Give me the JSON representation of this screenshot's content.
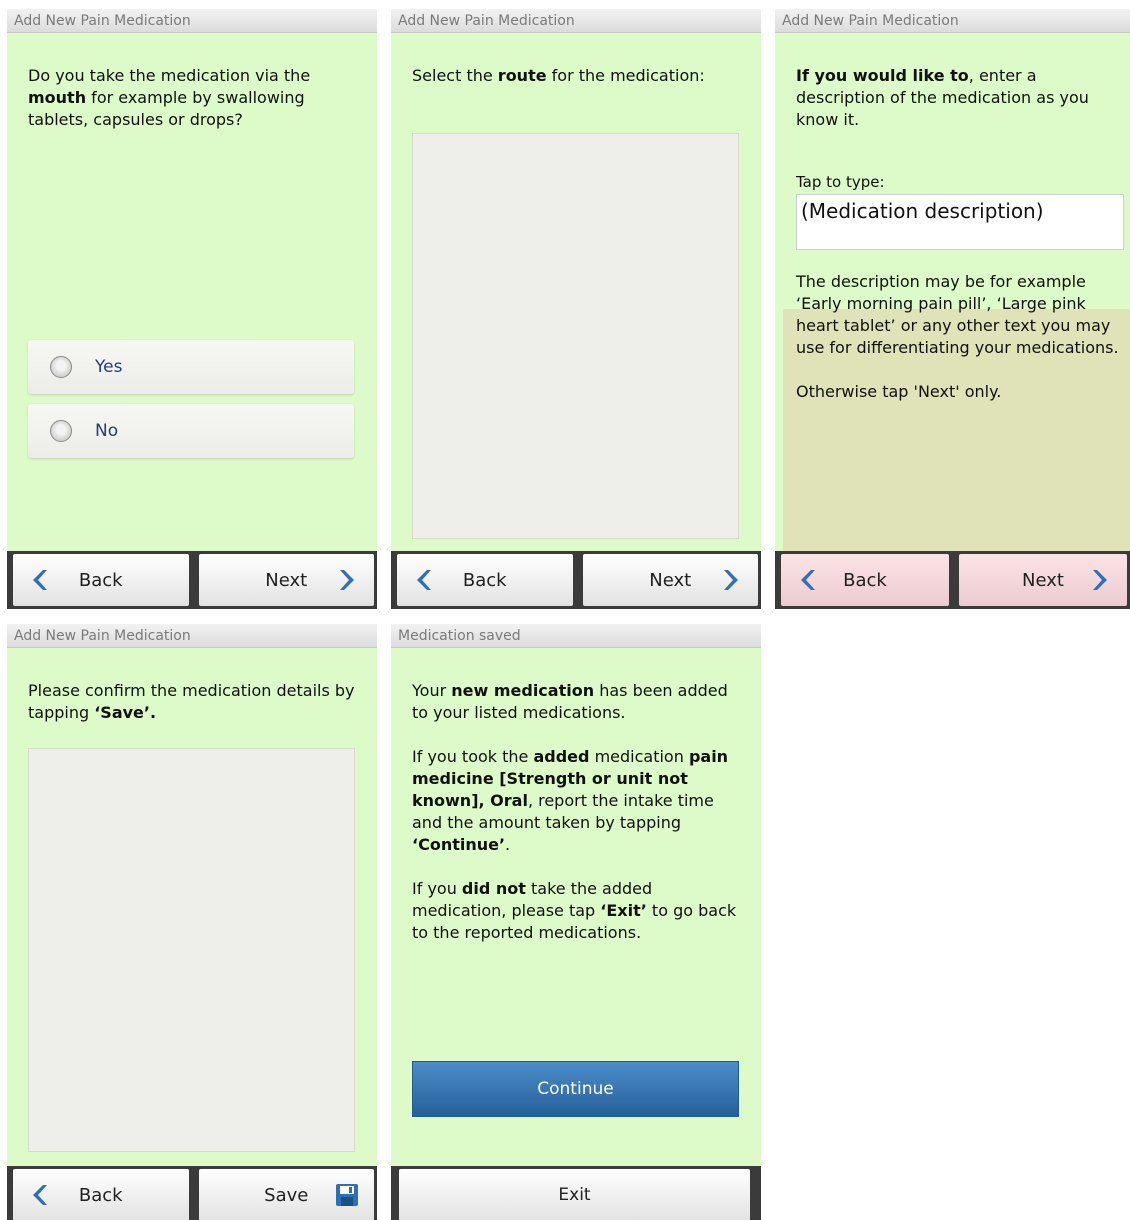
{
  "screen1": {
    "title": "Add New Pain Medication",
    "question": {
      "pre": "Do you take the medication via the ",
      "bold": "mouth",
      "post": " for example by swallowing tablets, capsules or drops?"
    },
    "options": [
      "Yes",
      "No"
    ],
    "back_label": "Back",
    "next_label": "Next"
  },
  "screen2": {
    "title": "Add New Pain Medication",
    "prompt": {
      "pre": "Select the ",
      "bold": "route",
      "post": " for the medication:"
    },
    "back_label": "Back",
    "next_label": "Next"
  },
  "screen3": {
    "title": "Add New Pain Medication",
    "intro": {
      "bold": "If you would like to",
      "post": ", enter a description of the medication as you know it."
    },
    "tap_label": "Tap to type:",
    "field_value": "(Medication description)",
    "example_text": "The description may be for example ‘Early morning pain pill’, ‘Large pink heart tablet’ or any other text you may use for differentiating your medications.",
    "otherwise_text": "Otherwise tap 'Next' only.",
    "back_label": "Back",
    "next_label": "Next"
  },
  "screen4": {
    "title": "Add New Pain Medication",
    "confirm": {
      "pre": "Please confirm the medication details by tapping ",
      "bold": "‘Save’."
    },
    "back_label": "Back",
    "save_label": "Save"
  },
  "screen5": {
    "title": "Medication saved",
    "p1": {
      "a": "Your ",
      "b": "new medication",
      "c": " has been added to your listed medications."
    },
    "p2": {
      "a": "If you took the ",
      "b": "added",
      "c": " medication ",
      "d": "pain medicine [Strength or unit not known], Oral",
      "e": ", report the intake time and the amount taken by tapping ",
      "f": "‘Continue’",
      "g": "."
    },
    "p3": {
      "a": "If you ",
      "b": "did not",
      "c": " take the added medication, please tap ",
      "d": "‘Exit’",
      "e": " to go back to the reported medications."
    },
    "continue_label": "Continue",
    "exit_label": "Exit"
  },
  "colors": {
    "screen_bg": "#dcfbc8",
    "accent_blue": "#2f6fb0",
    "arrow_blue": "#2e6fb8",
    "navbar": "#3b3b3b"
  }
}
